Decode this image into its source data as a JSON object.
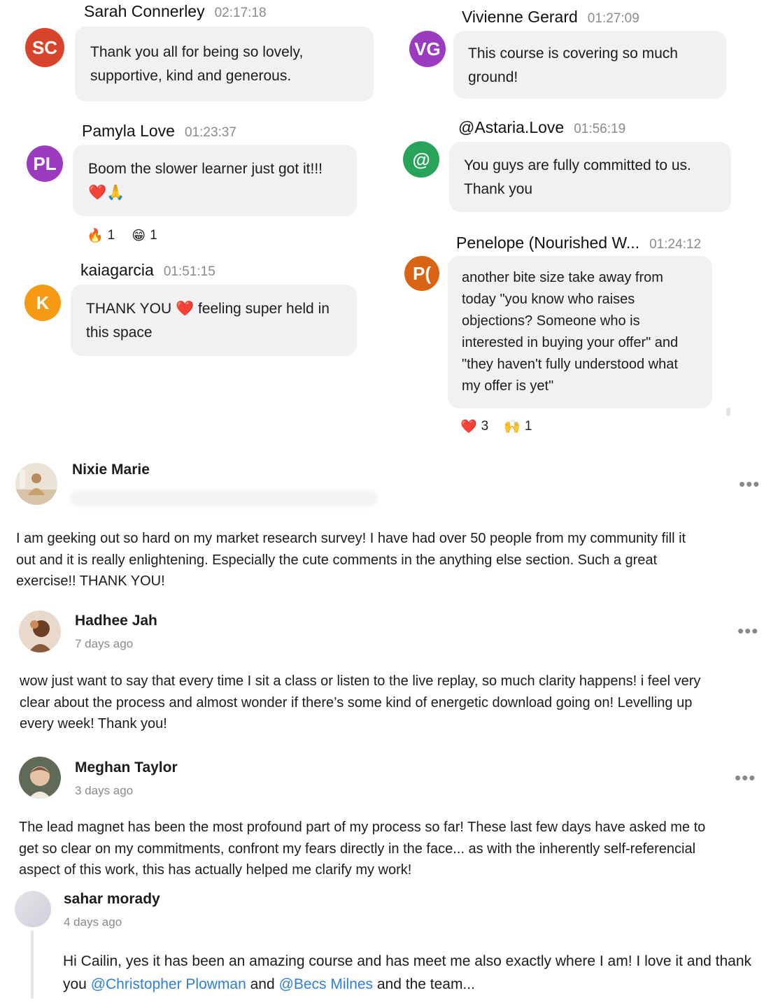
{
  "colors": {
    "sc": "#d8432b",
    "vg": "#9b3cc0",
    "pl": "#9b3cc0",
    "at": "#27a35a",
    "k": "#f59a12",
    "p": "#d96415",
    "mention": "#2f7fd6"
  },
  "chat": [
    {
      "initials": "SC",
      "name": "Sarah Connerley",
      "time": "02:17:18",
      "lines": [
        "Thank you all for being so lovely,",
        "supportive, kind and generous."
      ]
    },
    {
      "initials": "VG",
      "name": "Vivienne Gerard",
      "time": "01:27:09",
      "lines": [
        "This course is covering so much",
        "ground!"
      ]
    },
    {
      "initials": "PL",
      "name": "Pamyla Love",
      "time": "01:23:37",
      "lines": [
        "Boom the slower learner just got it!!!",
        "❤️🙏"
      ],
      "reactions": [
        {
          "icon": "fire-icon",
          "glyph": "🔥",
          "count": "1"
        },
        {
          "icon": "grin-icon",
          "glyph": "😁",
          "count": "1"
        }
      ]
    },
    {
      "initials": "@",
      "name": "@Astaria.Love",
      "time": "01:56:19",
      "lines": [
        "You guys are fully committed to us.",
        "Thank you"
      ]
    },
    {
      "initials": "K",
      "name": "kaiagarcia",
      "time": "01:51:15",
      "lines": [
        "THANK YOU ❤️ feeling super held in",
        "this space"
      ]
    },
    {
      "initials": "P(",
      "name": "Penelope (Nourished W...",
      "time": "01:24:12",
      "lines": [
        "another bite size take away from",
        "today \"you know who raises",
        "objections? Someone who is",
        "interested in buying your offer\" and",
        "\"they haven't fully understood what",
        "my offer is yet\""
      ],
      "reactions": [
        {
          "icon": "heart-icon",
          "glyph": "❤️",
          "count": "3"
        },
        {
          "icon": "raised-hands-icon",
          "glyph": "🙌",
          "count": "1"
        }
      ]
    }
  ],
  "posts": [
    {
      "author": "Nixie Marie",
      "time": "",
      "lines": [
        "I am geeking out so hard on my market research survey! I have had over 50 people from my community fill it",
        "out and it is really enlightening. Especially the cute comments in the anything else section. Such a great",
        "exercise!! THANK YOU!"
      ],
      "more": "•••"
    },
    {
      "author": "Hadhee Jah",
      "time": "7 days ago",
      "lines": [
        "wow just want to say that every time I sit a class or listen to the live replay, so much clarity happens! i feel very",
        "clear about the process and almost wonder if there’s some kind of energetic download going on! Levelling up",
        "every week! Thank you!"
      ],
      "more": "•••"
    },
    {
      "author": "Meghan Taylor",
      "time": "3 days ago",
      "lines": [
        "The lead magnet has been the most profound part of my process so far! These last few days have asked me to",
        "get so clear on my commitments, confront my fears directly in the face... as with the inherently self-referencial",
        "aspect of this work, this has actually helped me clarify my work!"
      ],
      "more": "•••"
    }
  ],
  "reply": {
    "author": "sahar morady",
    "time": "4 days ago",
    "line1": "Hi Cailin, yes it has been an amazing course and has meet me also exactly where I am! I love it and thank",
    "line2_pre": "you ",
    "mention1": "@Christopher Plowman",
    "mid": " and ",
    "mention2": "@Becs Milnes",
    "line2_post": " and the team..."
  }
}
